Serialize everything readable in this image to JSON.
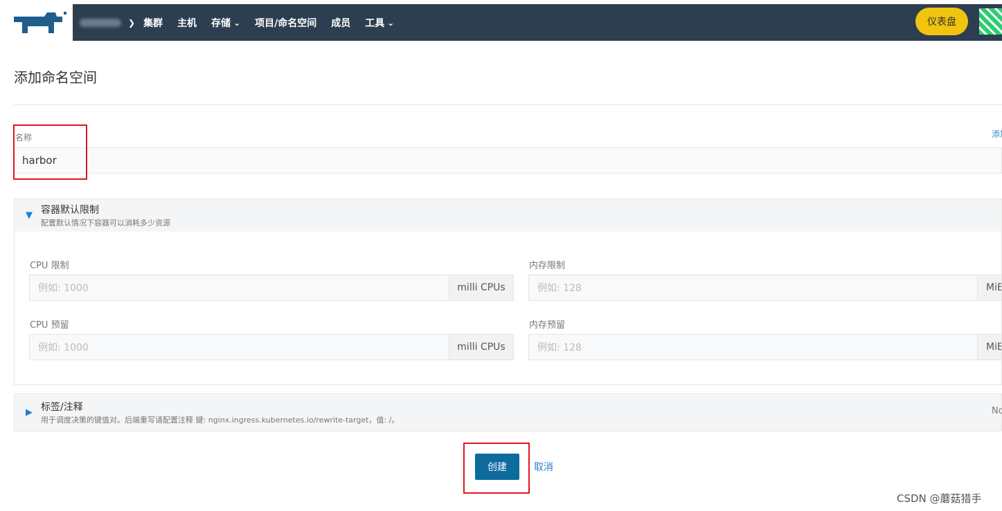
{
  "header": {
    "nav_items": [
      "集群",
      "主机",
      "存储",
      "项目/命名空间",
      "成员",
      "工具"
    ],
    "dashboard_label": "仪表盘"
  },
  "page": {
    "title": "添加命名空间",
    "name_label": "名称",
    "name_value": "harbor",
    "add_description_link": "添加"
  },
  "container_limits": {
    "title": "容器默认限制",
    "subtitle": "配置默认情况下容器可以消耗多少资源",
    "cpu_limit_label": "CPU 限制",
    "cpu_limit_placeholder": "例如: 1000",
    "cpu_limit_unit": "milli CPUs",
    "mem_limit_label": "内存限制",
    "mem_limit_placeholder": "例如: 128",
    "mem_limit_unit": "MiB",
    "cpu_reserve_label": "CPU 预留",
    "cpu_reserve_placeholder": "例如: 1000",
    "cpu_reserve_unit": "milli CPUs",
    "mem_reserve_label": "内存预留",
    "mem_reserve_placeholder": "例如: 128",
    "mem_reserve_unit": "MiB"
  },
  "labels_section": {
    "title": "标签/注释",
    "subtitle": "用于调度决策的键值对。后端重写请配置注释 键: nginx.ingress.kubernetes.io/rewrite-target，值: /。",
    "right_text": "No"
  },
  "actions": {
    "create_label": "创建",
    "cancel_label": "取消"
  },
  "watermark": "CSDN @蘑菇猎手"
}
